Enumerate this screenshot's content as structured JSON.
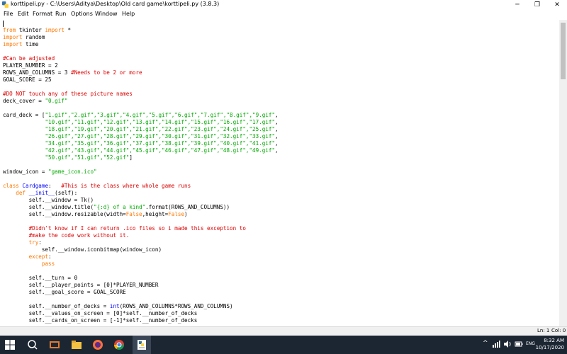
{
  "window": {
    "title": "korttipeli.py - C:\\Users\\Aditya\\Desktop\\Old card game\\korttipeli.py (3.8.3)",
    "minimize": "─",
    "maximize": "❐",
    "close": "✕"
  },
  "menu": [
    "File",
    "Edit",
    "Format",
    "Run",
    "Options",
    "Window",
    "Help"
  ],
  "code": {
    "l1": [
      "from",
      " tkinter ",
      "import",
      " *"
    ],
    "l2": [
      "import",
      " random"
    ],
    "l3": [
      "import",
      " time"
    ],
    "l4": "#Can be adjusted",
    "l5": "PLAYER_NUMBER = 2",
    "l6": [
      "ROWS_AND_COLUMNS = 3 ",
      "#Needs to be 2 or more"
    ],
    "l7": "GOAL_SCORE = 25",
    "l8": "#DO NOT touch any of these picture names",
    "l9": [
      "deck_cover = ",
      "\"0.gif\""
    ],
    "l10": [
      "card_deck = [",
      "\"1.gif\",\"2.gif\",\"3.gif\",\"4.gif\",\"5.gif\",\"6.gif\",\"7.gif\",\"8.gif\",\"9.gif\"",
      ","
    ],
    "l11": [
      "             ",
      "\"10.gif\",\"11.gif\",\"12.gif\",\"13.gif\",\"14.gif\",\"15.gif\",\"16.gif\",\"17.gif\"",
      ","
    ],
    "l12": [
      "             ",
      "\"18.gif\",\"19.gif\",\"20.gif\",\"21.gif\",\"22.gif\",\"23.gif\",\"24.gif\",\"25.gif\"",
      ","
    ],
    "l13": [
      "             ",
      "\"26.gif\",\"27.gif\",\"28.gif\",\"29.gif\",\"30.gif\",\"31.gif\",\"32.gif\",\"33.gif\"",
      ","
    ],
    "l14": [
      "             ",
      "\"34.gif\",\"35.gif\",\"36.gif\",\"37.gif\",\"38.gif\",\"39.gif\",\"40.gif\",\"41.gif\"",
      ","
    ],
    "l15": [
      "             ",
      "\"42.gif\",\"43.gif\",\"44.gif\",\"45.gif\",\"46.gif\",\"47.gif\",\"48.gif\",\"49.gif\"",
      ","
    ],
    "l16": [
      "             ",
      "\"50.gif\",\"51.gif\",\"52.gif\"",
      "]"
    ],
    "l17": [
      "window_icon = ",
      "\"game_icon.ico\""
    ],
    "l18": [
      "class",
      " ",
      "Cardgame",
      ":   ",
      "#This is the class where whole game runs"
    ],
    "l19": [
      "    ",
      "def",
      " ",
      "__init__",
      "(self):"
    ],
    "l20": "        self.__window = Tk()",
    "l21": [
      "        self.__window.title(",
      "\"{:d} of a kind\"",
      ".format(ROWS_AND_COLUMNS))"
    ],
    "l22": [
      "        self.__window.resizable(width=",
      "False",
      ",height=",
      "False",
      ")"
    ],
    "l23": "        #Didn't know if I can return .ico files so i made this exception to",
    "l24": "        #make the code work without it.",
    "l25": [
      "        ",
      "try",
      ":"
    ],
    "l26": "            self.__window.iconbitmap(window_icon)",
    "l27": [
      "        ",
      "except",
      ":"
    ],
    "l28": [
      "            ",
      "pass"
    ],
    "l29": "        self.__turn = 0",
    "l30": "        self.__player_points = [0]*PLAYER_NUMBER",
    "l31": "        self.__goal_score = GOAL_SCORE",
    "l32": [
      "        self.__number_of_decks = ",
      "int",
      "(ROWS_AND_COLUMNS*ROWS_AND_COLUMNS)"
    ],
    "l33": "        self.__values_on_screen = [0]*self.__number_of_decks",
    "l34": "        self.__cards_on_screen = [-1]*self.__number_of_decks"
  },
  "status": {
    "line": "Ln: 1",
    "col": "Col: 0"
  },
  "taskbar": {
    "time": "8:32 AM",
    "date": "10/17/2020",
    "icons": [
      "start-icon",
      "search-icon",
      "task-view-icon",
      "file-explorer-icon",
      "firefox-icon",
      "chrome-icon",
      "idle-icon"
    ],
    "tray": "^",
    "lang": "ENG"
  },
  "colors": {
    "keyword": "#ff7700",
    "string": "#00aa00",
    "comment": "#dd0000",
    "definition": "#0000ff"
  }
}
